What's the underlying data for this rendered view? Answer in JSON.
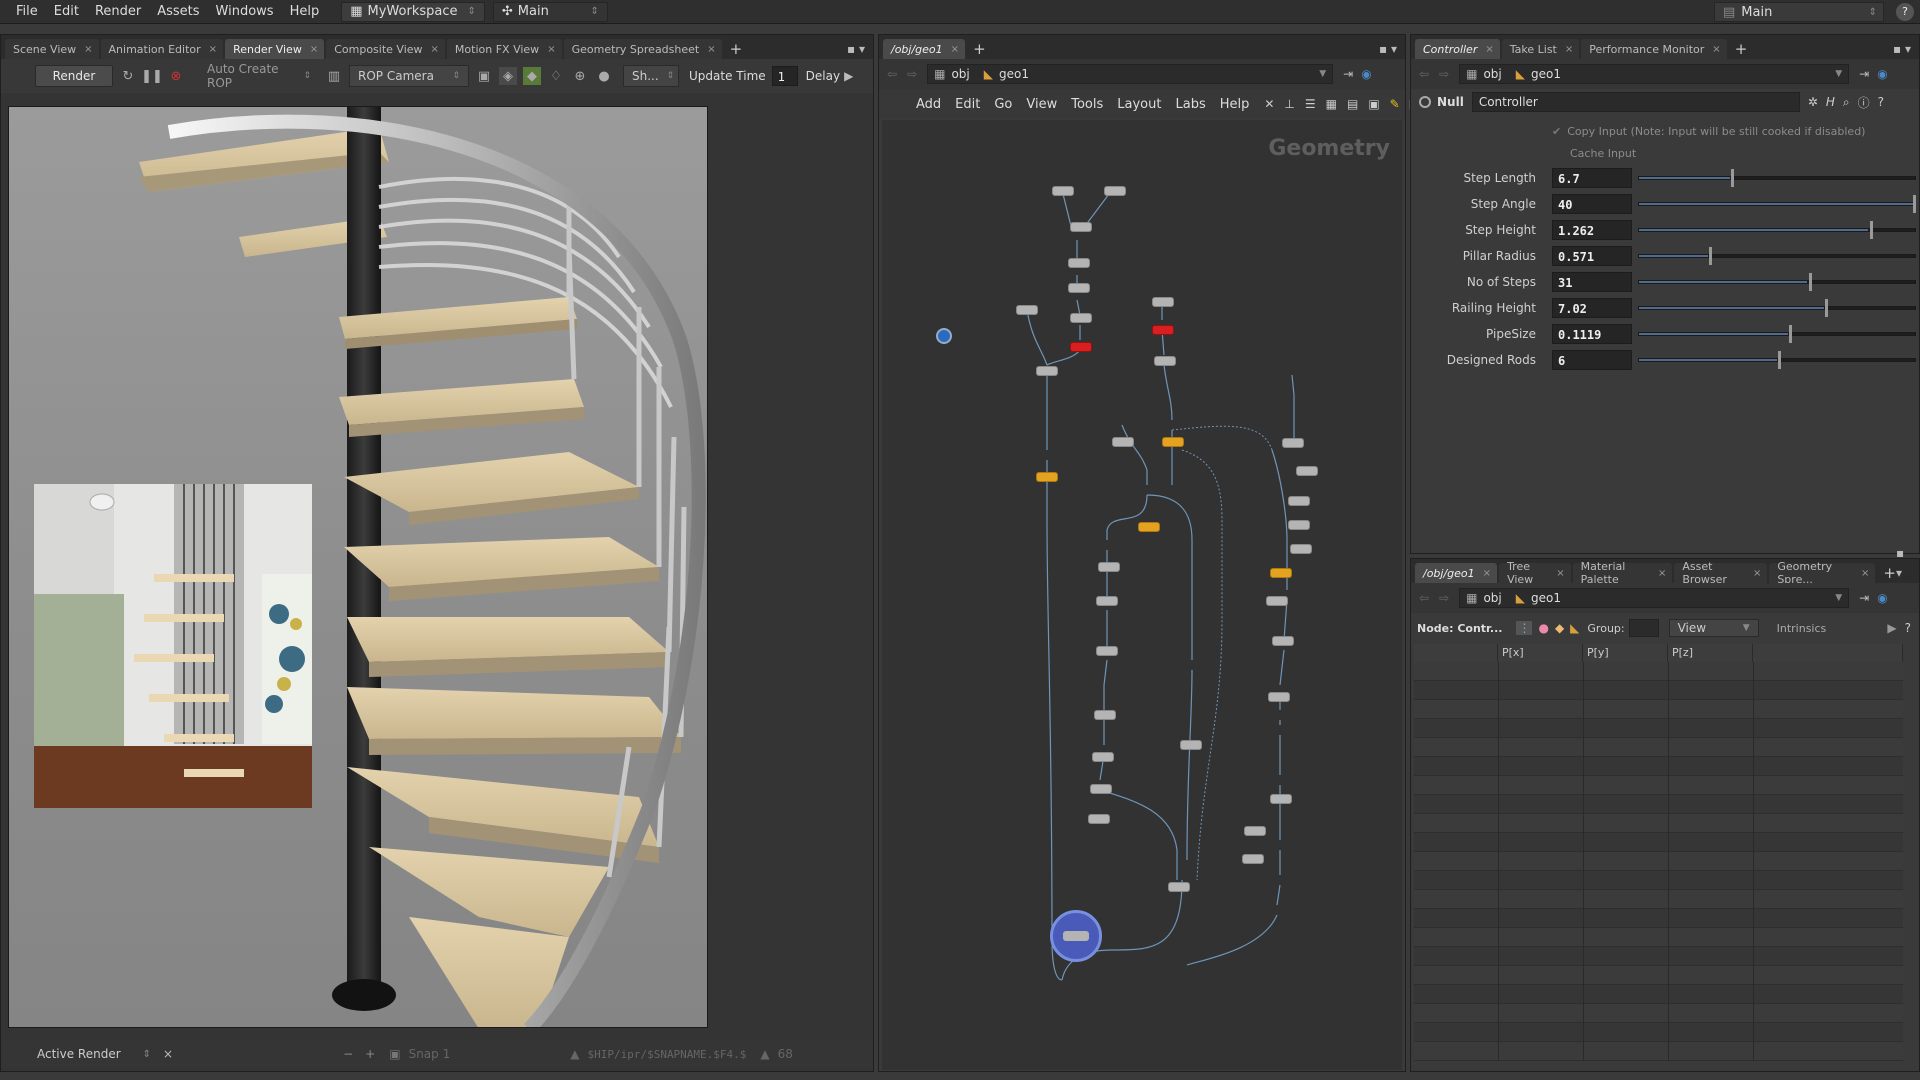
{
  "menubar": {
    "items": [
      "File",
      "Edit",
      "Render",
      "Assets",
      "Windows",
      "Help"
    ],
    "desktop": "MyWorkspace",
    "context": "Main",
    "right_desktop": "Main"
  },
  "left_pane": {
    "tabs": [
      "Scene View",
      "Animation Editor",
      "Render View",
      "Composite View",
      "Motion FX View",
      "Geometry Spreadsheet"
    ],
    "render_button": "Render",
    "auto_create": "Auto Create ROP",
    "camera": "ROP Camera",
    "shading": "Sh...",
    "update_time_label": "Update Time",
    "update_time_value": "1",
    "delay_label": "Delay",
    "status": {
      "active_render": "Active Render",
      "snap": "Snap 1",
      "path": "$HIP/ipr/$SNAPNAME.$F4.$",
      "frame": "68"
    }
  },
  "network_pane": {
    "tabs": [
      "/obj/geo1"
    ],
    "path_root": "obj",
    "path_node": "geo1",
    "menu": [
      "Add",
      "Edit",
      "Go",
      "View",
      "Tools",
      "Layout",
      "Labs",
      "Help"
    ],
    "watermark": "Geometry"
  },
  "param_pane": {
    "tabs": [
      "Controller",
      "Take List",
      "Performance Monitor"
    ],
    "path_root": "obj",
    "path_node": "geo1",
    "node_type": "Null",
    "node_name": "Controller",
    "copy_input": "Copy Input (Note: Input will be still cooked if disabled)",
    "cache_input": "Cache Input",
    "params": [
      {
        "label": "Step Length",
        "value": "6.7",
        "fraction": 0.33
      },
      {
        "label": "Step Angle",
        "value": "40",
        "fraction": 1.0
      },
      {
        "label": "Step Height",
        "value": "1.262",
        "fraction": 0.83
      },
      {
        "label": "Pillar Radius",
        "value": "0.571",
        "fraction": 0.25
      },
      {
        "label": "No of Steps",
        "value": "31",
        "fraction": 0.61
      },
      {
        "label": "Railing Height",
        "value": "7.02",
        "fraction": 0.67
      },
      {
        "label": "PipeSize",
        "value": "0.1119",
        "fraction": 0.54
      },
      {
        "label": "Designed Rods",
        "value": "6",
        "fraction": 0.5
      }
    ]
  },
  "sheet_pane": {
    "tabs": [
      "/obj/geo1",
      "Tree View",
      "Material Palette",
      "Asset Browser",
      "Geometry Spre..."
    ],
    "path_root": "obj",
    "path_node": "geo1",
    "node_label": "Node: Contr...",
    "group_label": "Group:",
    "view_label": "View",
    "intrinsics": "Intrinsics",
    "columns": [
      "P[x]",
      "P[y]",
      "P[z]"
    ]
  }
}
